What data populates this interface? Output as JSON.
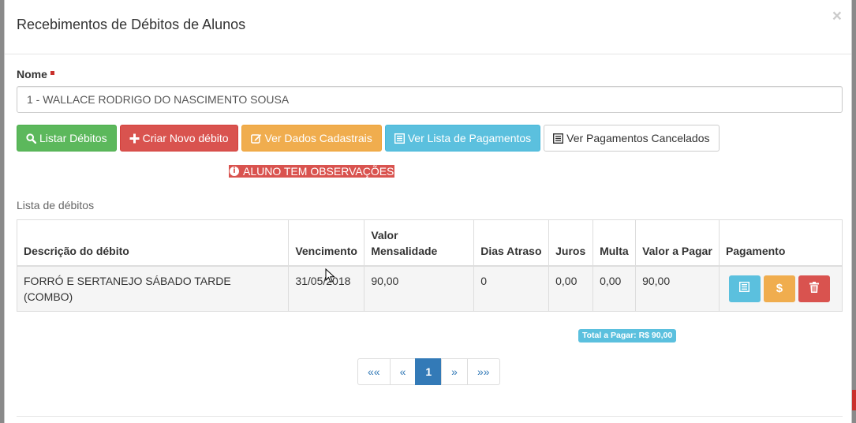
{
  "modal": {
    "title": "Recebimentos de Débitos de Alunos",
    "close_label": "×"
  },
  "form": {
    "name_label": "Nome",
    "name_value": "1 - WALLACE RODRIGO DO NASCIMENTO SOUSA"
  },
  "buttons": {
    "list_debts": "Listar Débitos",
    "create_debt": "Criar Novo débito",
    "view_registration": "Ver Dados Cadastrais",
    "view_payments": "Ver Lista de Pagamentos",
    "view_cancelled": "Ver Pagamentos Cancelados"
  },
  "alert": {
    "text": "ALUNO TEM OBSERVAÇÕES"
  },
  "table": {
    "section_label": "Lista de débitos",
    "headers": {
      "description": "Descrição do débito",
      "due_date": "Vencimento",
      "monthly_value": "Valor Mensalidade",
      "days_late": "Dias Atraso",
      "interest": "Juros",
      "fine": "Multa",
      "amount_due": "Valor a Pagar",
      "payment": "Pagamento"
    },
    "rows": [
      {
        "description": "FORRÓ E SERTANEJO SÁBADO TARDE (COMBO)",
        "due_date": "31/05/2018",
        "monthly_value": "90,00",
        "days_late": "0",
        "interest": "0,00",
        "fine": "0,00",
        "amount_due": "90,00"
      }
    ],
    "action_icons": [
      "list-icon",
      "dollar-icon",
      "trash-icon"
    ]
  },
  "total": {
    "label": "Total a Pagar: R$ 90,00"
  },
  "pagination": {
    "first": "««",
    "prev": "«",
    "current": "1",
    "next": "»",
    "last": "»»"
  },
  "colors": {
    "success": "#5cb85c",
    "danger": "#d9534f",
    "warning": "#f0ad4e",
    "info": "#5bc0de",
    "primary": "#337ab7"
  }
}
